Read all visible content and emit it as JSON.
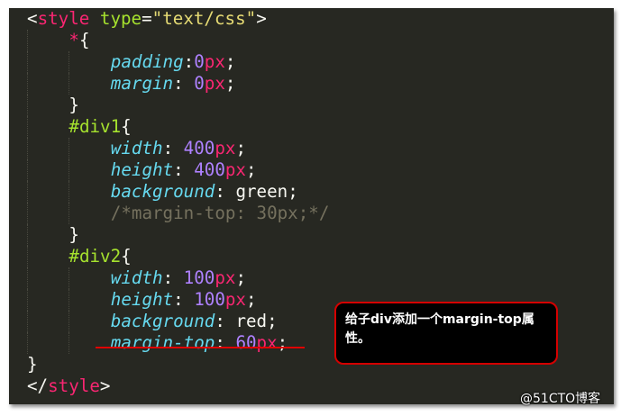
{
  "code_lines": [
    "<style type=\"text/css\">",
    "    *{",
    "        padding:0px;",
    "        margin: 0px;",
    "    }",
    "    #div1{",
    "        width: 400px;",
    "        height: 400px;",
    "        background: green;",
    "        /*margin-top: 30px;*/",
    "    }",
    "    #div2{",
    "        width: 100px;",
    "        height: 100px;",
    "        background: red;",
    "        margin-top: 60px;",
    "}",
    "</style>"
  ],
  "callout": {
    "text": "给子div添加一个margin-top属性。"
  },
  "watermark": "@51CTO博客",
  "theme": {
    "background": "#272822",
    "tag": "#f92672",
    "string": "#e6db74",
    "selector": "#a6e22e",
    "property": "#66d9ef",
    "number": "#ae81ff",
    "comment": "#75715e",
    "text": "#f8f8f2",
    "highlight": "#d40000"
  }
}
